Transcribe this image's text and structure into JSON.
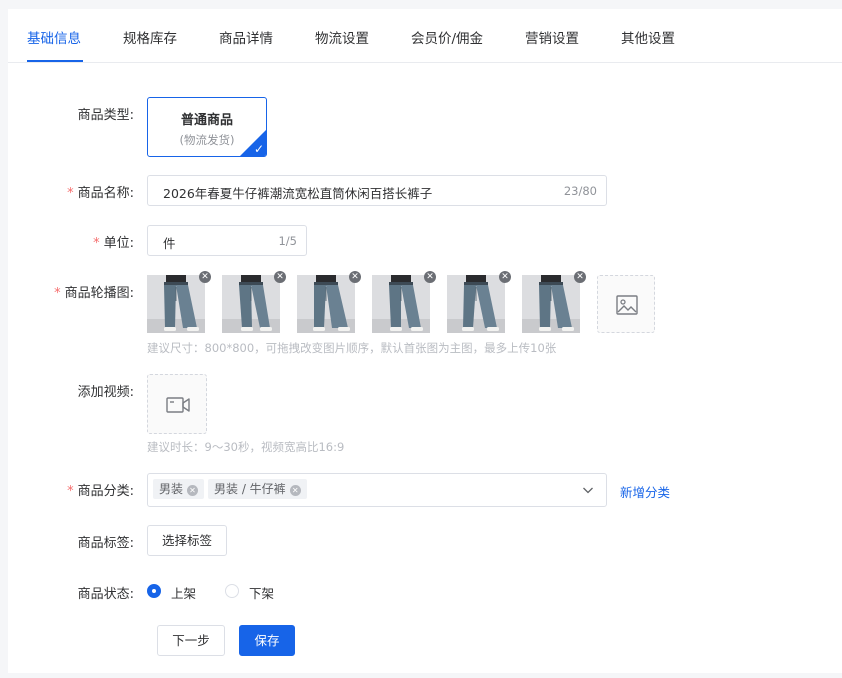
{
  "tabs": [
    {
      "label": "基础信息",
      "active": true
    },
    {
      "label": "规格库存",
      "active": false
    },
    {
      "label": "商品详情",
      "active": false
    },
    {
      "label": "物流设置",
      "active": false
    },
    {
      "label": "会员价/佣金",
      "active": false
    },
    {
      "label": "营销设置",
      "active": false
    },
    {
      "label": "其他设置",
      "active": false
    }
  ],
  "form": {
    "required_mark": "*",
    "product_type": {
      "label": "商品类型:",
      "option_title": "普通商品",
      "option_sub": "(物流发货)",
      "check_icon": "checkmark-icon"
    },
    "product_name": {
      "label": "商品名称:",
      "value": "2026年春夏牛仔裤潮流宽松直筒休闲百搭长裤子",
      "count": "23/80"
    },
    "unit": {
      "label": "单位:",
      "value": "件",
      "count": "1/5"
    },
    "carousel": {
      "label": "商品轮播图:",
      "image_count": 6,
      "delete_icon": "close-icon",
      "upload_icon": "image-icon",
      "hint": "建议尺寸：800*800，可拖拽改变图片顺序，默认首张图为主图，最多上传10张"
    },
    "video": {
      "label": "添加视频:",
      "upload_icon": "video-camera-icon",
      "hint": "建议时长：9～30秒，视频宽高比16:9"
    },
    "category": {
      "label": "商品分类:",
      "tags": [
        "男装",
        "男装 / 牛仔裤"
      ],
      "add_link": "新增分类"
    },
    "tags": {
      "label": "商品标签:",
      "button": "选择标签"
    },
    "status": {
      "label": "商品状态:",
      "options": [
        {
          "label": "上架",
          "selected": true
        },
        {
          "label": "下架",
          "selected": false
        }
      ]
    }
  },
  "actions": {
    "next": "下一步",
    "save": "保存"
  },
  "colors": {
    "primary": "#1764e8",
    "required": "#f56c6c"
  }
}
